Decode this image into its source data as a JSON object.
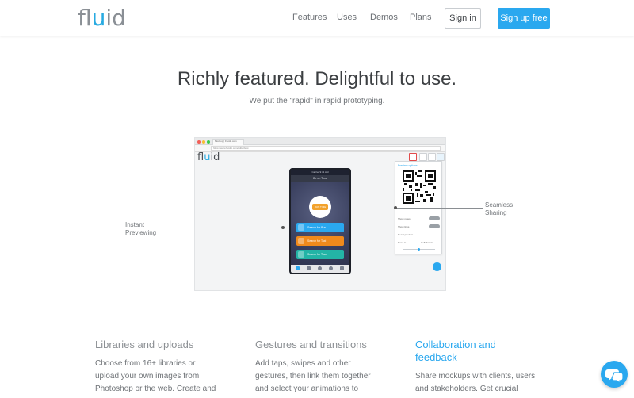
{
  "header": {
    "logo_prefix": "fl",
    "logo_accent": "u",
    "logo_suffix": "id",
    "nav": [
      "Features",
      "Uses",
      "Demos",
      "Plans"
    ],
    "signin_label": "Sign in",
    "signup_label": "Sign up free"
  },
  "hero": {
    "title": "Richly featured. Delightful to use.",
    "subtitle": "We put the \"rapid\" in rapid prototyping."
  },
  "mockup": {
    "tab_label": "Mockup | Fluidu.com",
    "url": "https://www.fluidui.com/editor/test",
    "logo_prefix": "fl",
    "logo_accent": "u",
    "logo_suffix": "id",
    "phone": {
      "status": "Carrier  9:41 AM",
      "nav_back": "Back",
      "nav_title": "Be on Time",
      "badge": "RUN TIME",
      "buttons": [
        {
          "label": "Search for Bus",
          "color": "#2aa8ef"
        },
        {
          "label": "Search for Taxi",
          "color": "#f08a1c"
        },
        {
          "label": "Search for Tram",
          "color": "#23b4a6"
        }
      ]
    },
    "panel": {
      "title": "Preview options",
      "rows": [
        "Show notes",
        "Show links",
        "Reset preview",
        "Send to",
        "Collaborate"
      ]
    }
  },
  "callouts": {
    "left": [
      "Instant",
      "Previewing"
    ],
    "right": [
      "Seamless",
      "Sharing"
    ]
  },
  "features": [
    {
      "title": "Libraries and uploads",
      "lines": [
        "Choose from 16+ libraries or",
        "upload your own images from",
        "Photoshop or the web. Create and"
      ]
    },
    {
      "title": "Gestures and transitions",
      "lines": [
        "Add taps, swipes and other",
        "gestures, then link them together",
        "and select your animations to"
      ]
    },
    {
      "title_lines": [
        "Collaboration and",
        "feedback"
      ],
      "lines": [
        "Share mockups with clients, users",
        "and stakeholders. Get crucial"
      ]
    }
  ],
  "colors": {
    "accent": "#2aa8ef",
    "text": "#3a3a3a",
    "muted": "#8c9094"
  },
  "icons": {
    "chat_widget": "chat-bubbles-icon"
  }
}
